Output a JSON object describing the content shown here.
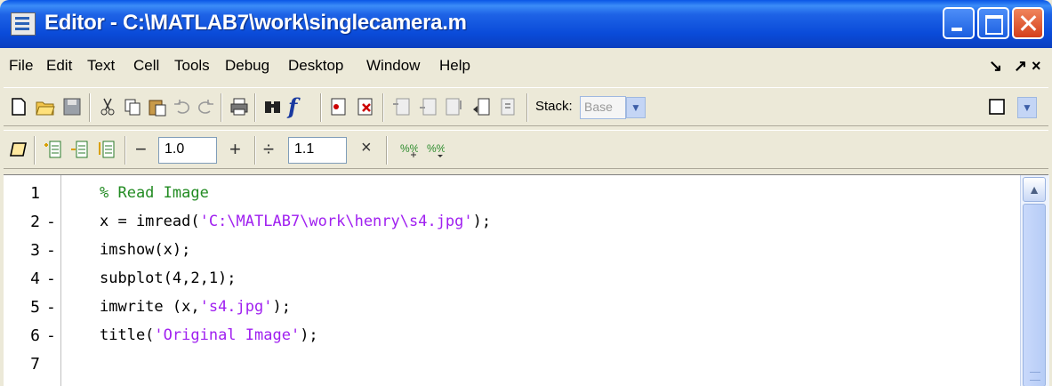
{
  "window": {
    "title": "Editor - C:\\MATLAB7\\work\\singlecamera.m"
  },
  "menubar": {
    "items": [
      "File",
      "Edit",
      "Text",
      "Cell",
      "Tools",
      "Debug",
      "Desktop",
      "Window",
      "Help"
    ],
    "controls": [
      "↘",
      "↗",
      "×"
    ]
  },
  "toolbar": {
    "stack_label": "Stack:",
    "stack_value": "Base"
  },
  "cell_toolbar": {
    "minus": "−",
    "plus": "+",
    "field1": "1.0",
    "divide": "÷",
    "field2": "1.1",
    "times": "×"
  },
  "editor": {
    "lines": [
      {
        "num": "1",
        "mark": "",
        "parts": [
          {
            "t": "% Read Image",
            "c": "comment"
          }
        ]
      },
      {
        "num": "2",
        "mark": "-",
        "parts": [
          {
            "t": "x = imread(",
            "c": ""
          },
          {
            "t": "'C:\\MATLAB7\\work\\henry\\s4.jpg'",
            "c": "str"
          },
          {
            "t": ");",
            "c": ""
          }
        ]
      },
      {
        "num": "3",
        "mark": "-",
        "parts": [
          {
            "t": "imshow(x);",
            "c": ""
          }
        ]
      },
      {
        "num": "4",
        "mark": "-",
        "parts": [
          {
            "t": "subplot(4,2,1);",
            "c": ""
          }
        ]
      },
      {
        "num": "5",
        "mark": "-",
        "parts": [
          {
            "t": "imwrite (x,",
            "c": ""
          },
          {
            "t": "'s4.jpg'",
            "c": "str"
          },
          {
            "t": ");",
            "c": ""
          }
        ]
      },
      {
        "num": "6",
        "mark": "-",
        "parts": [
          {
            "t": "title(",
            "c": ""
          },
          {
            "t": "'Original Image'",
            "c": "str"
          },
          {
            "t": ");",
            "c": ""
          }
        ]
      },
      {
        "num": "7",
        "mark": "",
        "parts": []
      }
    ]
  },
  "colors": {
    "comment": "#228b22",
    "string": "#a020f0",
    "titlebar": "#0a4bd9"
  }
}
